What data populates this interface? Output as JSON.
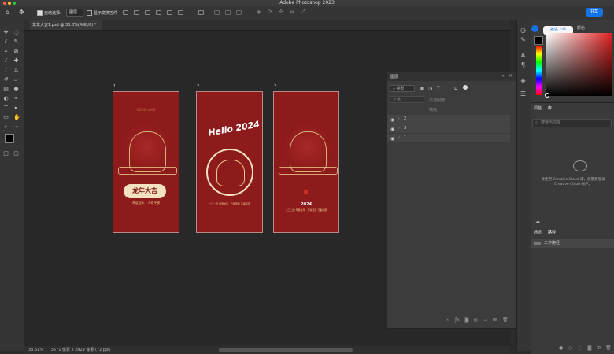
{
  "app": {
    "title": "Adobe Photoshop 2023"
  },
  "options_bar": {
    "auto_select_label": "自动选择:",
    "auto_select_value": "图层",
    "show_transform_label": "显示变换控件",
    "share_label": "共享"
  },
  "document": {
    "tab_title": "龙年大吉1.psd @ 33.8%(RGB/8) *",
    "zoom": "33.61%",
    "doc_info": "3571 像素 x 2829 像素 (72 ppi)"
  },
  "artboards": [
    {
      "label": "1",
      "headline": "龙年大吉",
      "subline": "鸿运当头 · 人寿平安",
      "tiny": "GOOD LUCK"
    },
    {
      "label": "2",
      "headline": "Hello 2024",
      "subline": "二〇二四 甲辰龙年 · 万象更新 万事如意",
      "tiny": ""
    },
    {
      "label": "3",
      "headline": "2024",
      "subline": "二〇二四 甲辰龙年 · 万象更新 万事如意",
      "tiny": ""
    }
  ],
  "layers_panel": {
    "title": "图层",
    "filter_kind": "类型",
    "blend_mode": "正常",
    "opacity_label": "不透明度:",
    "fill_label": "填充:",
    "rows": [
      {
        "name": "2"
      },
      {
        "name": "3"
      },
      {
        "name": "1"
      }
    ]
  },
  "right_panel": {
    "tip_label": "抢先上手",
    "color_tab": "颜色",
    "swatches_tab": "调整",
    "libraries_tab": "库",
    "search_placeholder": "搜索当前库",
    "cloud_message": "要使用 Creative Cloud 库，您需要登录 Creative Cloud 帐户。",
    "channels_tab": "通道",
    "paths_tab": "路径",
    "path_item": "工作路径"
  },
  "colors": {
    "accent": "#1473e6",
    "artboard_red": "#8e1b1b",
    "gold": "#e8c98a",
    "foreground": "#000000",
    "background": "#ffffff"
  }
}
